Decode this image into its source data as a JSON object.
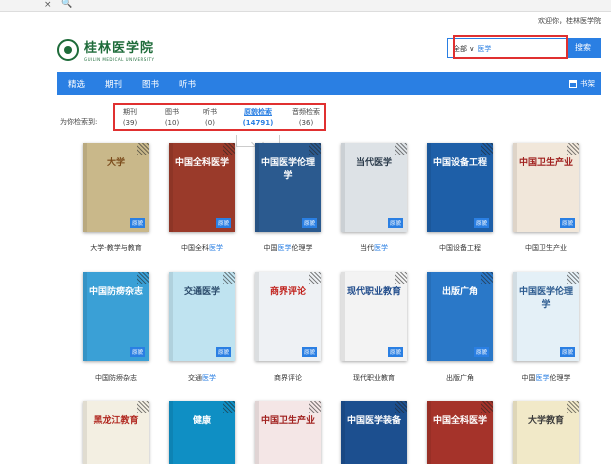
{
  "browser": {
    "close_glyph": "×",
    "search_glyph": "🔍"
  },
  "header": {
    "welcome": "欢迎你，桂林医学院",
    "logo_text": "桂林医学院",
    "logo_sub": "GUILIN MEDICAL UNIVERSITY"
  },
  "search": {
    "scope": "全部",
    "query": "医学",
    "button": "搜索"
  },
  "nav": {
    "items": [
      "精选",
      "期刊",
      "图书",
      "听书"
    ],
    "shelf": "书架"
  },
  "filters": {
    "label": "为你检索到:",
    "tabs": [
      {
        "label": "期刊",
        "count": "(39)"
      },
      {
        "label": "图书",
        "count": "(10)"
      },
      {
        "label": "听书",
        "count": "(0)"
      },
      {
        "label": "原貌检索",
        "count": "(14791)"
      },
      {
        "label": "音频检索",
        "count": "(36)"
      }
    ],
    "active_index": 3
  },
  "badge_label": "原貌",
  "results": [
    {
      "pre": "大学-教学与教育",
      "hl": "",
      "post": "",
      "cover_text": "大学",
      "bg": "#c9b88a",
      "fg": "#7a4a1a"
    },
    {
      "pre": "中国全科",
      "hl": "医学",
      "post": "",
      "cover_text": "中国全科医学",
      "bg": "#9a3a2a",
      "fg": "#ffffff"
    },
    {
      "pre": "中国",
      "hl": "医学",
      "post": "伦理学",
      "cover_text": "中国医学伦理学",
      "bg": "#2b5a8f",
      "fg": "#ffffff"
    },
    {
      "pre": "当代",
      "hl": "医学",
      "post": "",
      "cover_text": "当代医学",
      "bg": "#dde2e6",
      "fg": "#2a3a4a"
    },
    {
      "pre": "中国设备工程",
      "hl": "",
      "post": "",
      "cover_text": "中国设备工程",
      "bg": "#1e5fa8",
      "fg": "#ffffff"
    },
    {
      "pre": "中国卫生产业",
      "hl": "",
      "post": "",
      "cover_text": "中国卫生产业",
      "bg": "#f1e7da",
      "fg": "#a0201e"
    },
    {
      "pre": "中国防痨杂志",
      "hl": "",
      "post": "",
      "cover_text": "中国防痨杂志",
      "bg": "#3aa0d6",
      "fg": "#ffffff"
    },
    {
      "pre": "交通",
      "hl": "医学",
      "post": "",
      "cover_text": "交通医学",
      "bg": "#bfe3f0",
      "fg": "#2a4a6a"
    },
    {
      "pre": "商界评论",
      "hl": "",
      "post": "",
      "cover_text": "商界评论",
      "bg": "#eef1f4",
      "fg": "#c0201a"
    },
    {
      "pre": "现代职业教育",
      "hl": "",
      "post": "",
      "cover_text": "现代职业教育",
      "bg": "#f3f3f3",
      "fg": "#1e4a8a"
    },
    {
      "pre": "出版广角",
      "hl": "",
      "post": "",
      "cover_text": "出版广角",
      "bg": "#2a78c8",
      "fg": "#ffffff"
    },
    {
      "pre": "中国",
      "hl": "医学",
      "post": "伦理学",
      "cover_text": "中国医学伦理学",
      "bg": "#e4f0f7",
      "fg": "#2b5a8f"
    },
    {
      "pre": "",
      "hl": "",
      "post": "",
      "cover_text": "黑龙江教育",
      "bg": "#f3efe2",
      "fg": "#b0261e"
    },
    {
      "pre": "",
      "hl": "",
      "post": "",
      "cover_text": "健康",
      "bg": "#0f8fc4",
      "fg": "#ffffff"
    },
    {
      "pre": "",
      "hl": "",
      "post": "",
      "cover_text": "中国卫生产业",
      "bg": "#f4e6e6",
      "fg": "#a0201e"
    },
    {
      "pre": "",
      "hl": "",
      "post": "",
      "cover_text": "中国医学装备",
      "bg": "#1c4f8f",
      "fg": "#ffffff"
    },
    {
      "pre": "",
      "hl": "",
      "post": "",
      "cover_text": "中国全科医学",
      "bg": "#a5332a",
      "fg": "#ffffff"
    },
    {
      "pre": "",
      "hl": "",
      "post": "",
      "cover_text": "大学教育",
      "bg": "#f1e9c8",
      "fg": "#3a3a3a"
    }
  ]
}
